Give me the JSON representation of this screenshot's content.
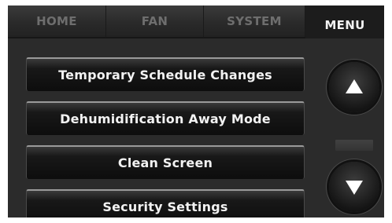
{
  "tabs": [
    {
      "label": "HOME"
    },
    {
      "label": "FAN"
    },
    {
      "label": "SYSTEM"
    },
    {
      "label": "MENU"
    }
  ],
  "menu": {
    "items": [
      {
        "label": "Temporary Schedule Changes"
      },
      {
        "label": "Dehumidification Away Mode"
      },
      {
        "label": "Clean Screen"
      },
      {
        "label": "Security Settings"
      }
    ]
  },
  "scroll": {
    "up_icon": "arrow-up-icon",
    "down_icon": "arrow-down-icon"
  },
  "colors": {
    "background": "#2b2b2b",
    "active_tab": "#1c1c1c",
    "inactive_tab_text": "#6e6e6e",
    "text": "#f2f2f2"
  }
}
